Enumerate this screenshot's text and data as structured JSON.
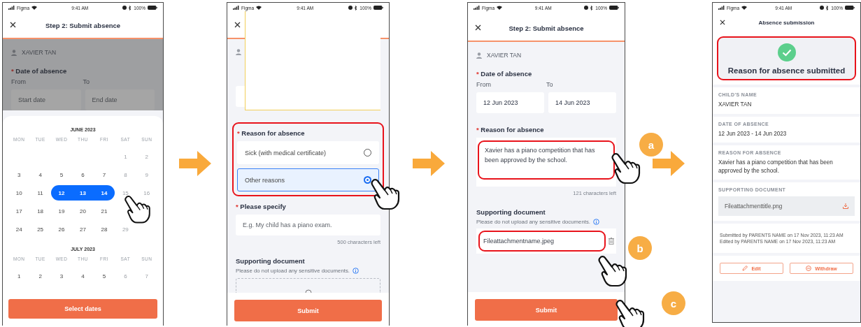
{
  "calendar_screen": {
    "status_bar": {
      "carrier": "Figma",
      "time": "9:41 AM",
      "battery": "100%"
    },
    "title": "Step 2: Submit absence",
    "child_name": "XAVIER TAN",
    "date_label": {
      "mark": "*",
      "text": "Date of absence"
    },
    "from_label": "From",
    "to_label": "To",
    "start_placeholder": "Start date",
    "end_placeholder": "End date",
    "months": [
      {
        "title": "JUNE 2023",
        "weekdays": [
          "MON",
          "TUE",
          "WED",
          "THU",
          "FRI",
          "SAT",
          "SUN"
        ],
        "weeks": [
          [
            {
              "kind": "blank"
            },
            {
              "kind": "blank"
            },
            {
              "kind": "blank"
            },
            {
              "kind": "blank"
            },
            {
              "kind": "blank"
            },
            {
              "label": "1",
              "selected": false,
              "disabled": true
            },
            {
              "label": "2",
              "selected": false,
              "disabled": true
            }
          ],
          [
            {
              "label": "3",
              "selected": false,
              "disabled": false
            },
            {
              "label": "4",
              "selected": false,
              "disabled": false
            },
            {
              "label": "5",
              "selected": false,
              "disabled": false
            },
            {
              "label": "6",
              "selected": false,
              "disabled": false
            },
            {
              "label": "7",
              "selected": false,
              "disabled": false
            },
            {
              "label": "8",
              "selected": false,
              "disabled": true
            },
            {
              "label": "9",
              "selected": false,
              "disabled": true
            }
          ],
          [
            {
              "label": "10",
              "selected": false,
              "disabled": false
            },
            {
              "label": "11",
              "selected": false,
              "disabled": false
            },
            {
              "label": "12",
              "selected": true,
              "disabled": false
            },
            {
              "label": "13",
              "selected": true,
              "disabled": false
            },
            {
              "label": "14",
              "selected": true,
              "disabled": false
            },
            {
              "label": "15",
              "selected": false,
              "disabled": true
            },
            {
              "label": "16",
              "selected": false,
              "disabled": true
            }
          ],
          [
            {
              "label": "17",
              "selected": false,
              "disabled": false
            },
            {
              "label": "18",
              "selected": false,
              "disabled": false
            },
            {
              "label": "19",
              "selected": false,
              "disabled": false
            },
            {
              "label": "20",
              "selected": false,
              "disabled": false
            },
            {
              "label": "21",
              "selected": false,
              "disabled": false
            },
            {
              "kind": "blank"
            },
            {
              "kind": "blank"
            }
          ],
          [
            {
              "label": "24",
              "selected": false,
              "disabled": false
            },
            {
              "label": "25",
              "selected": false,
              "disabled": false
            },
            {
              "label": "26",
              "selected": false,
              "disabled": false
            },
            {
              "label": "27",
              "selected": false,
              "disabled": false
            },
            {
              "label": "28",
              "selected": false,
              "disabled": false
            },
            {
              "label": "29",
              "selected": false,
              "disabled": true
            }
          ]
        ]
      },
      {
        "title": "JULY 2023",
        "weekdays": [
          "MON",
          "TUE",
          "WED",
          "THU",
          "FRI",
          "SAT",
          "SUN"
        ],
        "weeks": [
          [
            {
              "label": "1",
              "selected": false,
              "disabled": false
            },
            {
              "label": "2",
              "selected": false,
              "disabled": false
            },
            {
              "label": "3",
              "selected": false,
              "disabled": false
            },
            {
              "label": "4",
              "selected": false,
              "disabled": false
            },
            {
              "label": "5",
              "selected": false,
              "disabled": false
            },
            {
              "label": "6",
              "selected": false,
              "disabled": true
            },
            {
              "label": "7",
              "selected": false,
              "disabled": true
            }
          ]
        ]
      }
    ],
    "button": "Select dates"
  },
  "reason_screen": {
    "status_bar": {
      "carrier": "Figma",
      "time": "9:41 AM",
      "battery": "100%"
    },
    "reason_label": {
      "mark": "*",
      "text": "Reason for absence"
    },
    "options": [
      {
        "label": "Sick (with medical certificate)",
        "selected": false
      },
      {
        "label": "Other reasons",
        "selected": true
      }
    ],
    "specify_label": {
      "mark": "*",
      "text": "Please specify"
    },
    "specify_placeholder": "E.g. My child has a piano exam.",
    "characters_left": "500 characters left",
    "document_label": "Supporting document",
    "document_note": "Please do not upload any sensitive documents.",
    "button": "Submit"
  },
  "filled_screen": {
    "status_bar": {
      "carrier": "Figma",
      "time": "9:41 AM",
      "battery": "100%"
    },
    "title": "Step 2: Submit absence",
    "child_name": "XAVIER TAN",
    "date_label": {
      "mark": "*",
      "text": "Date of absence"
    },
    "from_label": "From",
    "to_label": "To",
    "start_date": "12 Jun 2023",
    "end_date": "14 Jun 2023",
    "reason_label": {
      "mark": "*",
      "text": "Reason for absence"
    },
    "reason": "Xavier has a piano competition that has been approved by the school.",
    "characters_left": "121 characters left",
    "document_label": "Supporting document",
    "document_note": "Please do not upload any sensitive documents.",
    "file_name": "Fileattachmentname.jpeg",
    "button": "Submit"
  },
  "confirmation_screen": {
    "status_bar": {
      "carrier": "Figma",
      "time": "9:41 AM",
      "battery": "100%"
    },
    "title": "Absence submission",
    "message": "Reason for absence submitted",
    "sections": [
      {
        "kind": "text",
        "label": "CHILD'S NAME",
        "value": "XAVIER TAN"
      },
      {
        "kind": "text",
        "label": "DATE OF ABSENCE",
        "value": "12 Jun 2023 - 14 Jun 2023"
      },
      {
        "kind": "text",
        "label": "REASON FOR ABSENCE",
        "value": "Xavier has a piano competition that has been approved by the school."
      },
      {
        "kind": "file",
        "label": "SUPPORTING DOCUMENT",
        "value": "Fileattachmenttitle.png"
      }
    ],
    "history": [
      "Submitted by PARENTS NAME on 17 Nov 2023, 11:23 AM",
      "Edited by PARENTS NAME on 17 Nov 2023, 11:23 AM"
    ],
    "edit_button": "Edit",
    "withdraw_button": "Withdraw"
  },
  "callouts": [
    {
      "label": "a"
    },
    {
      "label": "b"
    },
    {
      "label": "c"
    }
  ]
}
